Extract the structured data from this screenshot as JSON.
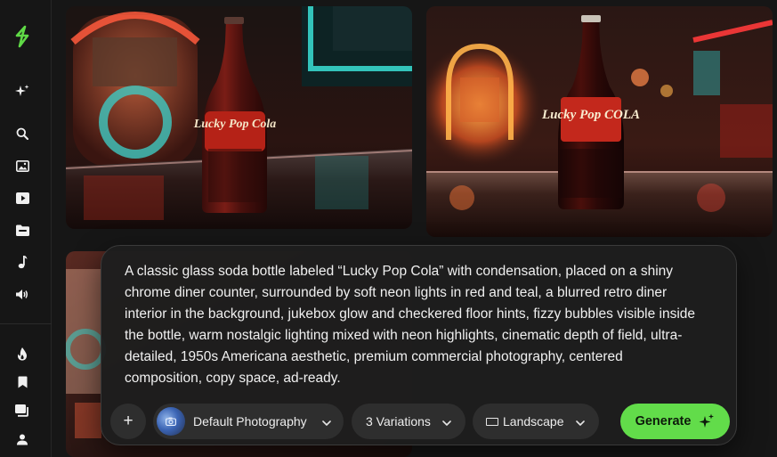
{
  "colors": {
    "accent": "#62dc4a",
    "background": "#161616",
    "panel": "#1e1e1e",
    "pill": "#2e2e2e"
  },
  "sidebar": {
    "items": [
      {
        "icon": "logo-bolt-icon"
      },
      {
        "icon": "sparkle-new-icon"
      },
      {
        "icon": "search-icon"
      },
      {
        "icon": "image-icon"
      },
      {
        "icon": "video-icon"
      },
      {
        "icon": "folder-icon"
      },
      {
        "icon": "music-note-icon"
      },
      {
        "icon": "speaker-icon"
      },
      {
        "icon": "flame-icon"
      },
      {
        "icon": "bookmark-icon"
      },
      {
        "icon": "stacked-images-icon"
      },
      {
        "icon": "user-icon"
      }
    ]
  },
  "gallery": {
    "images": [
      {
        "label": "Lucky Pop Cola"
      },
      {
        "label": "Lucky Pop COLA"
      },
      {
        "label": ""
      }
    ]
  },
  "prompt": {
    "text": "A classic glass soda bottle labeled “Lucky Pop Cola” with condensation, placed on a shiny chrome diner counter, surrounded by soft neon lights in red and teal, a blurred retro diner interior in the background, jukebox glow and checkered floor hints, fizzy bubbles visible inside the bottle, warm nostalgic lighting mixed with neon highlights, cinematic depth of field, ultra-detailed, 1950s Americana aesthetic, premium commercial photography, centered composition, copy space, ad-ready."
  },
  "controls": {
    "add_label": "+",
    "style_label": "Default Photography",
    "variations_label": "3 Variations",
    "aspect_label": "Landscape",
    "generate_label": "Generate"
  }
}
